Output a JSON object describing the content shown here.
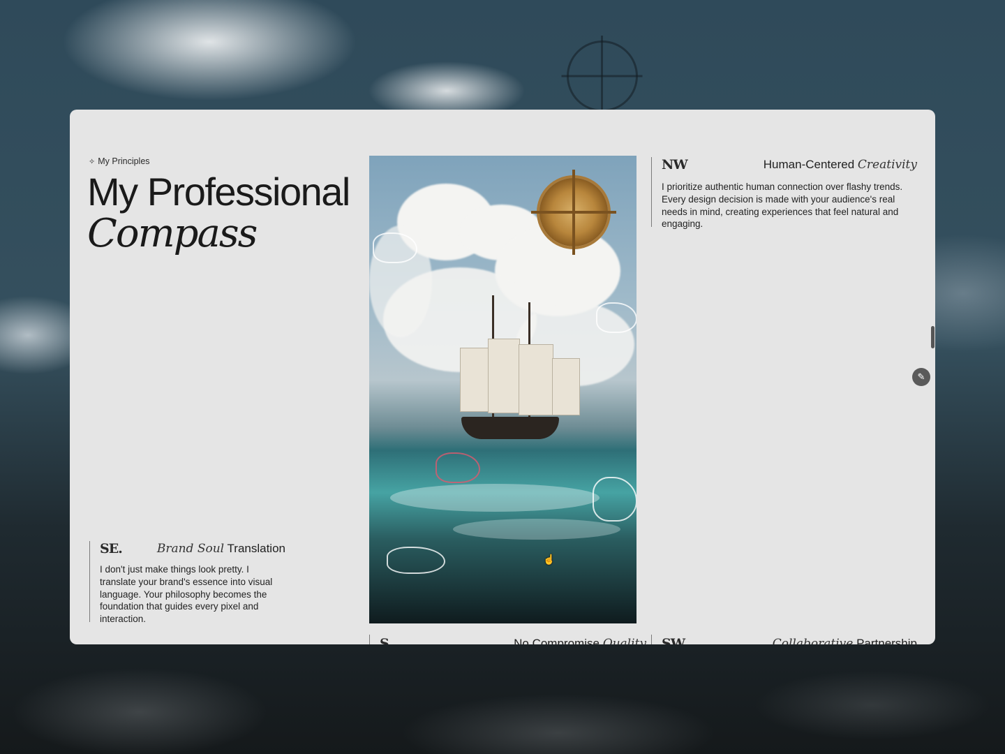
{
  "section": {
    "eyebrow": "My Principles",
    "title_line1": "My Professional",
    "title_line2": "Compass"
  },
  "cards": {
    "se": {
      "code": "SE.",
      "title_italic": "Brand Soul",
      "title_rest": "Translation",
      "body": "I don't just make things look pretty. I translate your brand's essence into visual language. Your philosophy becomes the foundation that guides every pixel and interaction."
    },
    "nw": {
      "code": "NW",
      "title_plain": "Human-Centered",
      "title_italic": "Creativity",
      "body": "I prioritize authentic human connection over flashy trends. Every design decision is made with your audience's real needs in mind, creating experiences that feel natural and engaging."
    },
    "s": {
      "code": "S",
      "title_plain": "No Compromise",
      "title_italic": "Quality"
    },
    "sw": {
      "code": "SW",
      "title_italic": "Collaborative",
      "title_rest": "Partnership"
    }
  },
  "icons": {
    "eyebrow_icon": "✧",
    "edit_icon": "✎",
    "cursor_icon": "☝"
  }
}
